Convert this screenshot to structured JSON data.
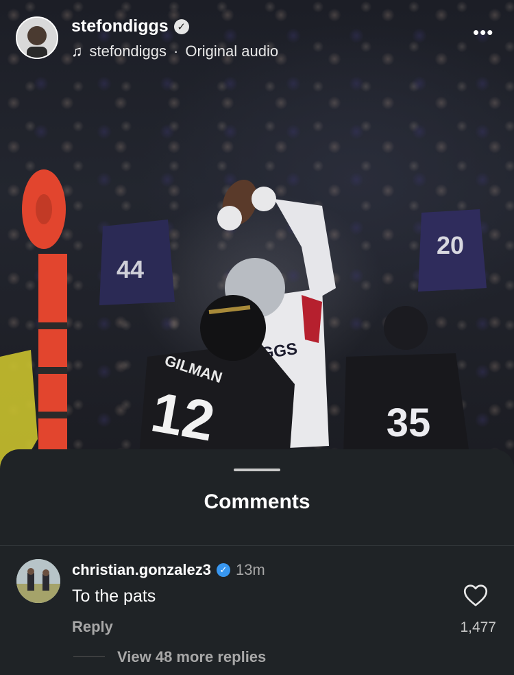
{
  "post": {
    "username": "stefondiggs",
    "audio_owner": "stefondiggs",
    "audio_separator": "·",
    "audio_label": "Original audio",
    "jersey_numbers": {
      "defender": "12",
      "defender_name": "GILMAN",
      "receiver_name": "IGGS",
      "right_player": "35",
      "fan_left": "44",
      "fan_right": "20"
    }
  },
  "comments_sheet": {
    "title": "Comments",
    "comment": {
      "username": "christian.gonzalez3",
      "time": "13m",
      "text": "To the pats",
      "reply_label": "Reply",
      "likes": "1,477",
      "view_replies": "View 48 more replies"
    }
  },
  "icons": {
    "verified_top": "verified-badge-icon",
    "verified_comment": "verified-badge-icon",
    "music": "music-note-icon",
    "more": "more-options-icon",
    "heart": "heart-icon"
  },
  "colors": {
    "sheet_background": "#1f2326",
    "verified_blue": "#3897f0",
    "muted_text": "#a8a8a8"
  }
}
